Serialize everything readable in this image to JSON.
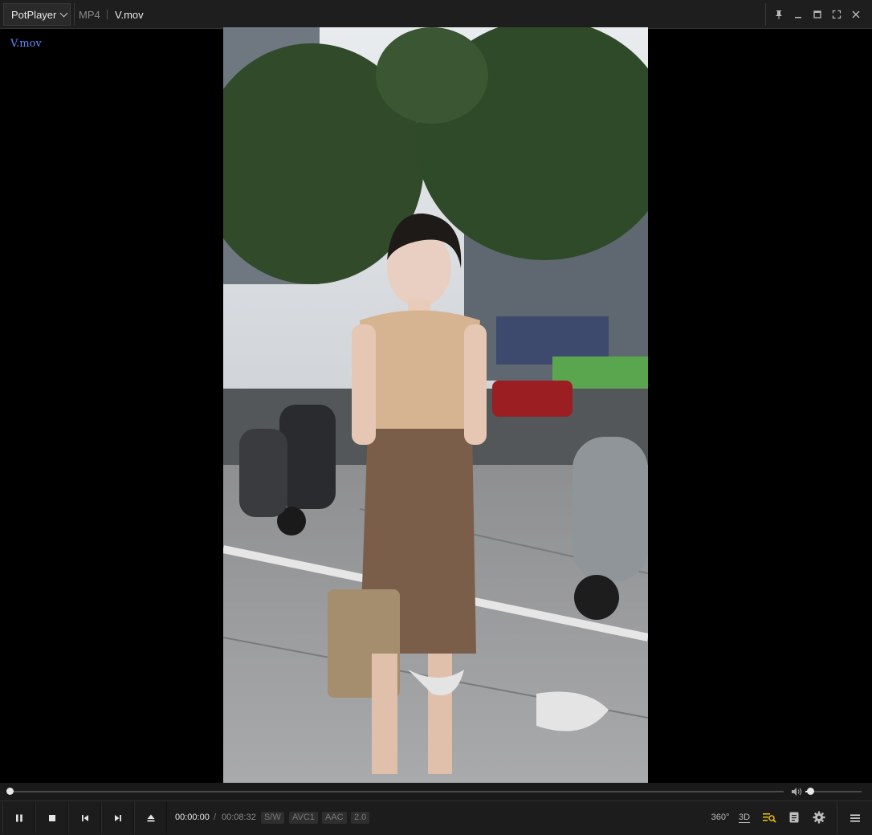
{
  "app": {
    "brand_label": "PotPlayer",
    "format_label": "MP4",
    "file_name": "V.mov"
  },
  "osd": {
    "filename": "V.mov"
  },
  "window_controls": [
    "pin-icon",
    "minimize-icon",
    "maximize-icon",
    "fullscreen-icon",
    "close-icon"
  ],
  "playback": {
    "position_fraction": 0.0,
    "volume_fraction": 0.08
  },
  "controls": {
    "current_time": "00:00:00",
    "separator": "/",
    "total_time": "00:08:32",
    "badges": [
      "S/W",
      "AVC1",
      "AAC",
      "2.0"
    ],
    "right_labels": {
      "vr": "360°",
      "three_d": "3D"
    }
  },
  "colors": {
    "osd_text": "#5b8cff",
    "accent_playlist": "#f2c200",
    "titlebar_bg": "#1e1e1e"
  }
}
